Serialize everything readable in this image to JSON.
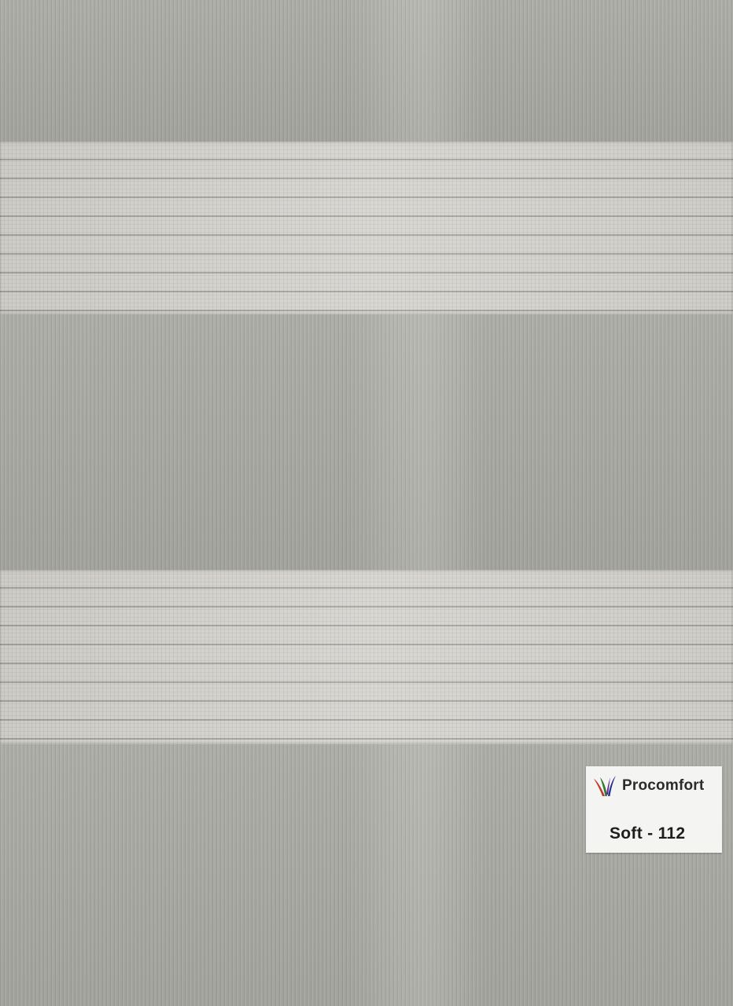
{
  "label": {
    "brand": "Procomfort",
    "product_code": "Soft - 112",
    "logo_icon": "leaf-stripes-logo-icon",
    "logo_colors": [
      "#c0392b",
      "#2e7d32",
      "#283593",
      "#6a1b9a"
    ]
  },
  "fabric": {
    "dark_band_color": "#a8a9a2",
    "light_band_color": "#d6d4cf",
    "card_color": "#f4f4f2"
  }
}
